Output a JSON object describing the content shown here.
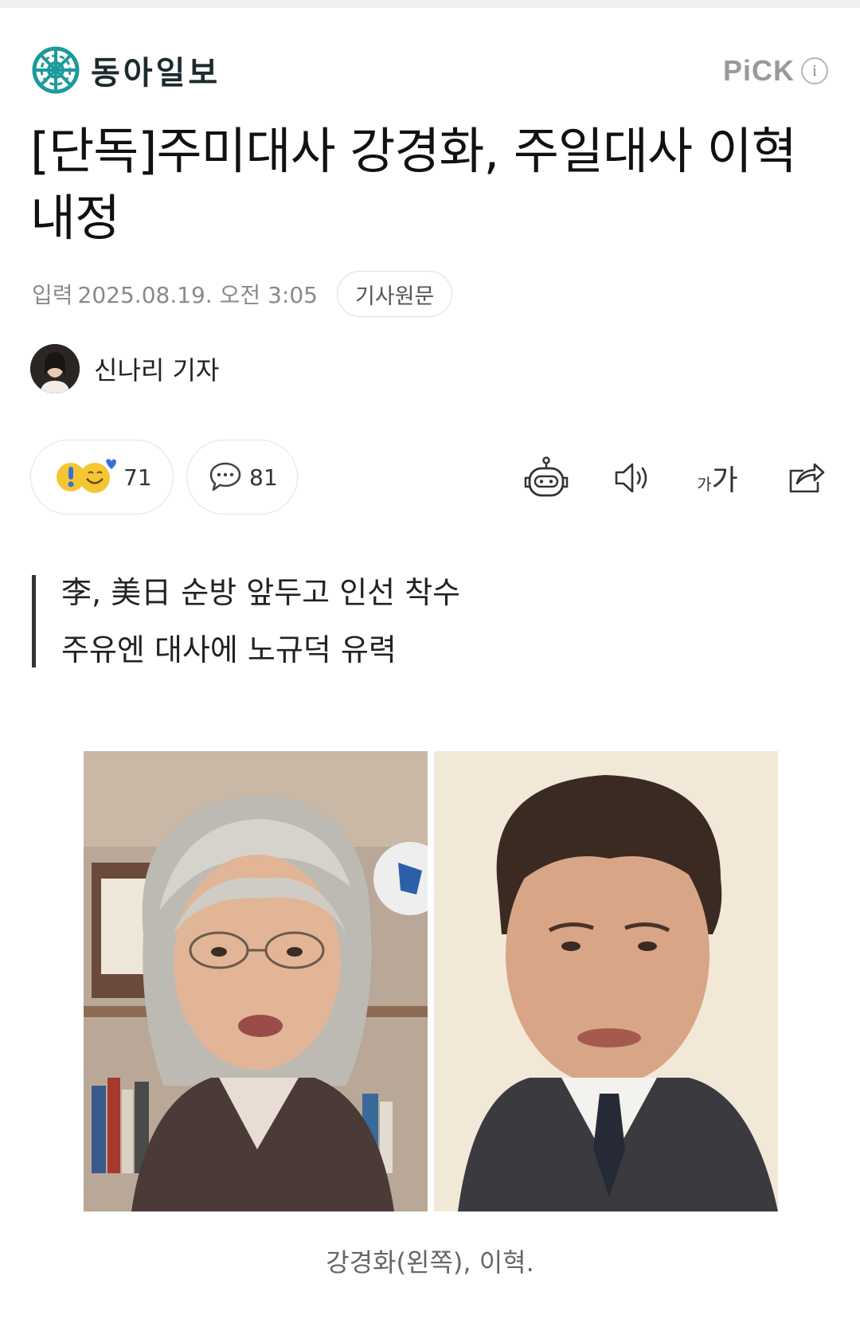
{
  "header": {
    "logo_text": "동아일보",
    "pick_label": "PiCK",
    "info_label": "i"
  },
  "article": {
    "headline": "[단독]주미대사 강경화, 주일대사 이혁 내정",
    "input_label": "입력",
    "date": "2025.08.19. 오전 3:05",
    "original_button": "기사원문",
    "reporter": "신나리 기자"
  },
  "actions": {
    "reaction_count": "71",
    "comment_count": "81",
    "font_small": "가",
    "font_big": "가"
  },
  "summary": [
    "李, 美日 순방 앞두고 인선 착수",
    "주유엔 대사에 노규덕 유력"
  ],
  "photo": {
    "caption": "강경화(왼쪽), 이혁."
  },
  "icons": {
    "logo": "dong-a-logo-icon",
    "bot": "robot-icon",
    "speaker": "speaker-icon",
    "share": "share-icon",
    "comment": "speech-bubble-icon",
    "reaction": "reaction-emoji-icon"
  },
  "colors": {
    "logo_teal": "#1e9a9a",
    "text_primary": "#111111",
    "text_muted": "#8a8a8a"
  }
}
